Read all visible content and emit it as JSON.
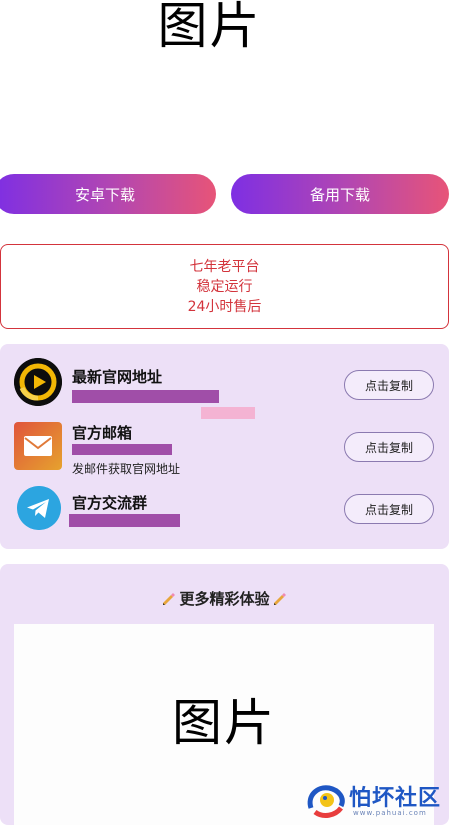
{
  "top_image": {
    "placeholder_text": "图片"
  },
  "downloads": {
    "android_label": "安卓下载",
    "backup_label": "备用下载"
  },
  "info": {
    "lines": [
      "七年老平台",
      "稳定运行",
      "24小时售后"
    ]
  },
  "links": [
    {
      "title": "最新官网地址",
      "icon": "play-logo-icon",
      "button": "点击复制"
    },
    {
      "title": "官方邮箱",
      "icon": "mail-icon",
      "button": "点击复制",
      "note": "发邮件获取官网地址"
    },
    {
      "title": "官方交流群",
      "icon": "telegram-icon",
      "button": "点击复制"
    }
  ],
  "more": {
    "title": "更多精彩体验",
    "icon": "pencil-icon",
    "image_placeholder": "图片"
  },
  "watermark": {
    "text": "怕坏社区",
    "url": "www.pahuai.com"
  },
  "colors": {
    "gradient_start": "#7e2fe3",
    "gradient_end": "#e75478",
    "info_red": "#d3343c",
    "card_bg": "#ede0f7",
    "redaction": "#a04ea8"
  }
}
